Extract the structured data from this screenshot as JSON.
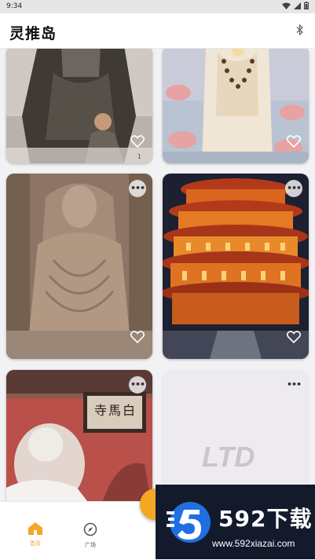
{
  "status_bar": {
    "time": "9:34"
  },
  "app": {
    "title": "灵推岛"
  },
  "feed": {
    "cards": [
      {
        "name": "card-monk-child",
        "likes": "1"
      },
      {
        "name": "card-lotus-monk"
      },
      {
        "name": "card-stone-buddha"
      },
      {
        "name": "card-pagoda"
      },
      {
        "name": "card-temple-gate",
        "plaque_text": "寺馬白"
      },
      {
        "name": "card-placeholder",
        "placeholder_text": "LTD"
      }
    ]
  },
  "bottom_nav": {
    "items": [
      {
        "label": "首页",
        "icon": "home-icon",
        "active": true
      },
      {
        "label": "广场",
        "icon": "compass-icon",
        "active": false
      }
    ]
  },
  "watermark": {
    "brand": "592下载",
    "url": "www.592xiazai.com"
  },
  "colors": {
    "accent": "#f5a623",
    "watermark_bg": "#121a2c",
    "logo_blue": "#1f6fe0"
  }
}
